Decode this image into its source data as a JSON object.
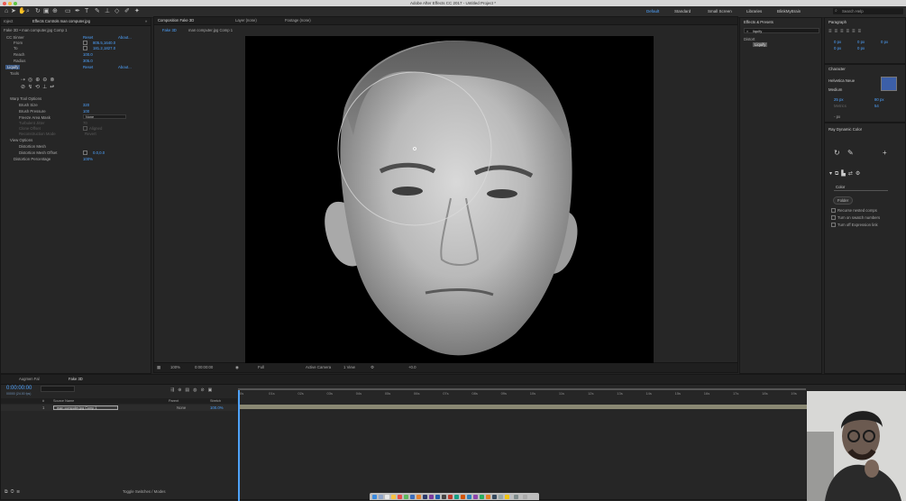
{
  "app": {
    "title": "Adobe After Effects CC 2017 - Untitled Project *",
    "workspaces": [
      "Default",
      "Standard",
      "Small Screen",
      "Libraries",
      "BlinkMyBrain"
    ],
    "search_placeholder": "Search Help"
  },
  "project_panel": {
    "tab": "roject",
    "effect_controls_tab": "Effects Controls man computer.jpg",
    "layer_path": "Fake 3D • man computer.jpg Comp 1",
    "effects": [
      {
        "name": "CC Sinner",
        "reset": "Reset",
        "about": "About..."
      },
      {
        "name": "From",
        "value": "805.5,1640.0"
      },
      {
        "name": "To",
        "value": "181.2,1827.0"
      },
      {
        "name": "Reach",
        "value": "100.0"
      },
      {
        "name": "Radius",
        "value": "305.0"
      },
      {
        "name": "Liquify",
        "reset": "Reset",
        "about": "About..."
      },
      {
        "name": "Tools"
      },
      {
        "name": "Warp Tool Options"
      },
      {
        "name": "Brush Size",
        "value": "320"
      },
      {
        "name": "Brush Pressure",
        "value": "100"
      },
      {
        "name": "Freeze Area Mask",
        "value": "None"
      },
      {
        "name": "Turbulent Jitter",
        "value": "70"
      },
      {
        "name": "Clone Offset",
        "value": "Aligned"
      },
      {
        "name": "Reconstruction Mode",
        "value": "Revert"
      },
      {
        "name": "View Options"
      },
      {
        "name": "Distortion Mesh"
      },
      {
        "name": "Distortion Mesh Offset",
        "value": "0.0,0.0"
      },
      {
        "name": "Distortion Percentage",
        "value": "100%"
      }
    ]
  },
  "composition": {
    "tabs": [
      "Composition Fake 3D",
      "Layer (none)",
      "Footage (none)"
    ],
    "subtabs": [
      "Fake 3D",
      "man computer.jpg Comp 1"
    ],
    "footer": {
      "zoom": "100%",
      "timecode": "0:00:00:00",
      "resolution": "Full",
      "camera": "Active Camera",
      "views": "1 View",
      "exposure": "+0.0"
    }
  },
  "effects_presets": {
    "title": "Effects & Presets",
    "search_value": "liquify",
    "category": "Distort",
    "result": "Liquify"
  },
  "paragraph": {
    "title": "Paragraph",
    "values": [
      "0 px",
      "0 px",
      "0 px",
      "0 px",
      "0 px"
    ]
  },
  "character": {
    "title": "Character",
    "font": "Helvetica Neue",
    "style": "Medium",
    "size": "25 px",
    "leading": "80 px",
    "kerning": "Metrics",
    "tracking": "54",
    "baseline": "- px"
  },
  "ray_dynamic_color": {
    "title": "Ray Dynamic Color",
    "dropdown": "Color",
    "folder_button": "Folder",
    "options": [
      "Recurse nested comps",
      "Turn on swatch numbers",
      "Turn off Expression link"
    ]
  },
  "timeline": {
    "tabs": [
      "Augmen Fal",
      "Fake 3D"
    ],
    "timecode": "0:00:00:00",
    "fps": "00000 (24.00 fps)",
    "columns": [
      "#",
      "Source Name",
      "Parent",
      "Stretch"
    ],
    "layers": [
      {
        "index": "1",
        "name": "man computer.jpg Comp 1",
        "parent": "None",
        "stretch": "100.0%"
      }
    ],
    "ruler": [
      "0s",
      "01s",
      "02s",
      "03s",
      "04s",
      "05s",
      "06s",
      "07s",
      "08s",
      "09s",
      "10s",
      "11s",
      "12s",
      "13s",
      "14s",
      "15s",
      "16s",
      "17s",
      "18s",
      "19s",
      "20s",
      "21s",
      "22s"
    ],
    "footer": "Toggle Switches / Modes"
  },
  "colors": {
    "accent": "#4ea3ff",
    "panel_bg": "#262626",
    "canvas_bg": "#000000",
    "layer_bar": "#8a8873"
  }
}
